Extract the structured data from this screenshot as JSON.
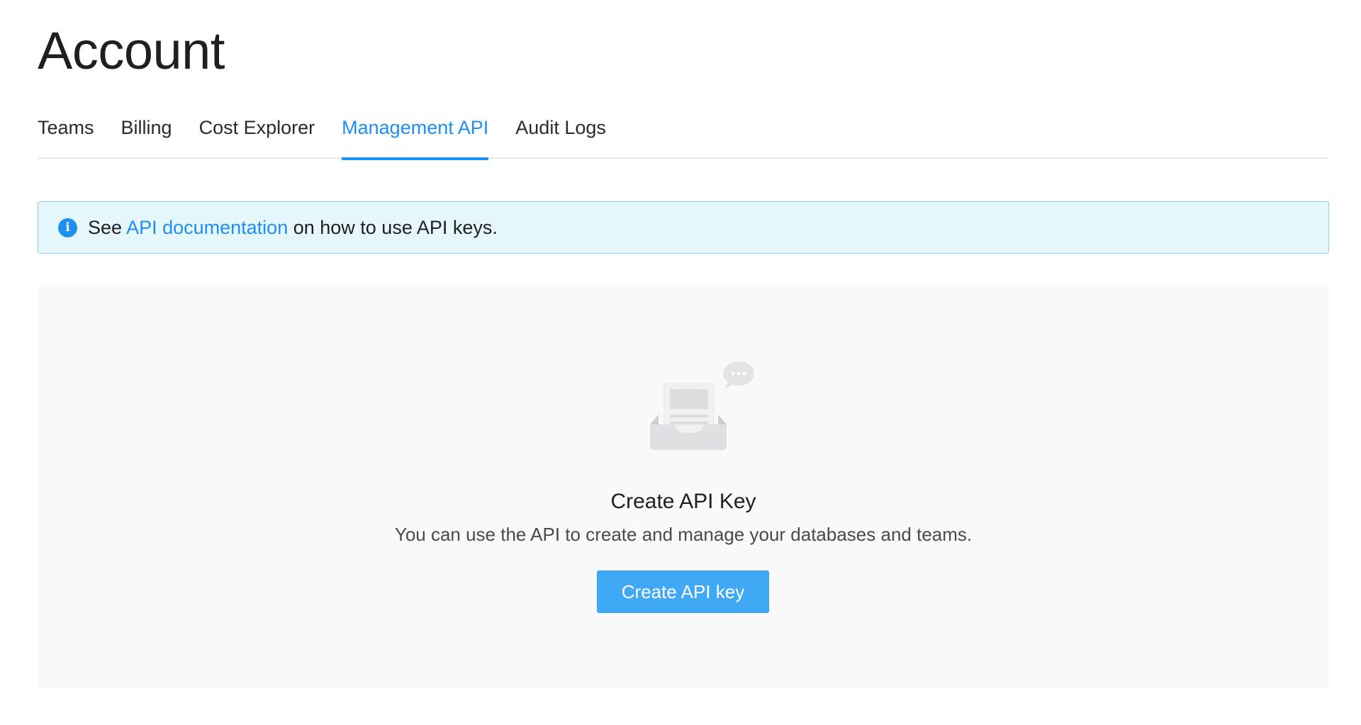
{
  "page": {
    "title": "Account"
  },
  "tabs": [
    {
      "label": "Teams",
      "active": false
    },
    {
      "label": "Billing",
      "active": false
    },
    {
      "label": "Cost Explorer",
      "active": false
    },
    {
      "label": "Management API",
      "active": true
    },
    {
      "label": "Audit Logs",
      "active": false
    }
  ],
  "info_banner": {
    "icon": "info-icon",
    "prefix": "See ",
    "link_text": "API documentation",
    "suffix": " on how to use API keys."
  },
  "empty_state": {
    "illustration": "inbox-document-icon",
    "title": "Create API Key",
    "description": "You can use the API to create and manage your databases and teams.",
    "button_label": "Create API key"
  },
  "colors": {
    "accent": "#1d8ff2",
    "banner_bg": "#e6f6fd",
    "banner_border": "#8ed2f2",
    "button_bg": "#3fa9f5",
    "panel_bg": "#f9f9f9"
  }
}
